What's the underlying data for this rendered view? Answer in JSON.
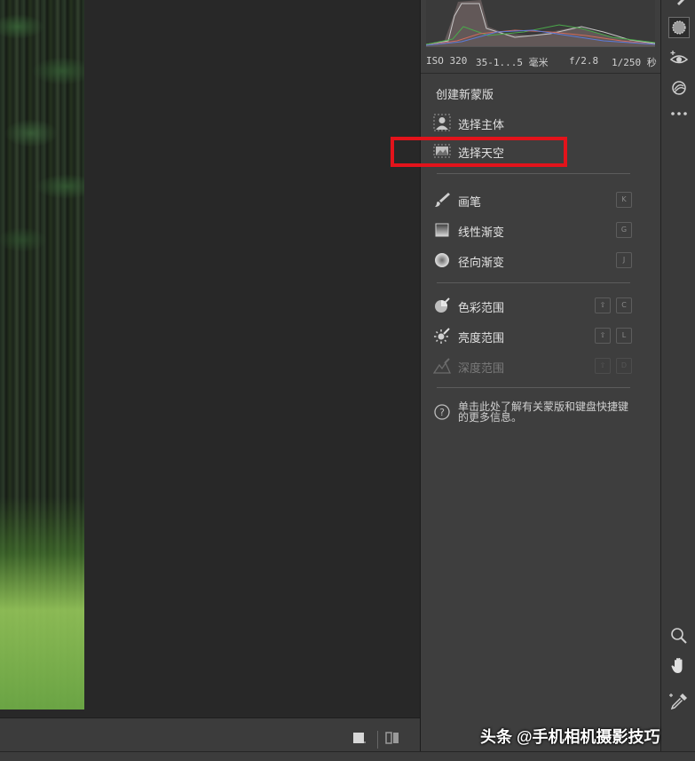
{
  "exif": {
    "iso": "ISO 320",
    "focal": "35-1...5 毫米",
    "aperture": "f/2.8",
    "shutter": "1/250 秒"
  },
  "mask_panel": {
    "title": "创建新蒙版",
    "groups": [
      [
        {
          "name": "select-subject",
          "label": "选择主体",
          "icon": "person-icon"
        },
        {
          "name": "select-sky",
          "label": "选择天空",
          "icon": "sky-icon"
        }
      ],
      [
        {
          "name": "brush",
          "label": "画笔",
          "icon": "brush-icon",
          "keys": [
            "K"
          ]
        },
        {
          "name": "linear-gradient",
          "label": "线性渐变",
          "icon": "linear-gradient-icon",
          "keys": [
            "G"
          ]
        },
        {
          "name": "radial-gradient",
          "label": "径向渐变",
          "icon": "radial-gradient-icon",
          "keys": [
            "J"
          ]
        }
      ],
      [
        {
          "name": "color-range",
          "label": "色彩范围",
          "icon": "color-range-icon",
          "keys": [
            "⇧",
            "C"
          ]
        },
        {
          "name": "luminance-range",
          "label": "亮度范围",
          "icon": "luminance-range-icon",
          "keys": [
            "⇧",
            "L"
          ]
        },
        {
          "name": "depth-range",
          "label": "深度范围",
          "icon": "depth-range-icon",
          "keys": [
            "⇧",
            "D"
          ],
          "disabled": true
        }
      ]
    ],
    "help_text": "单击此处了解有关蒙版和键盘快捷键的更多信息。"
  },
  "highlight_color": "#e3131b",
  "toolstrip": {
    "top_tools": [
      "edit-brush-icon",
      "masking-icon",
      "red-eye-icon",
      "presets-icon",
      "more-icon"
    ],
    "bottom_tools": [
      "zoom-icon",
      "hand-icon",
      "eyedropper-icon"
    ]
  },
  "watermark": "头条 @手机相机摄影技巧"
}
